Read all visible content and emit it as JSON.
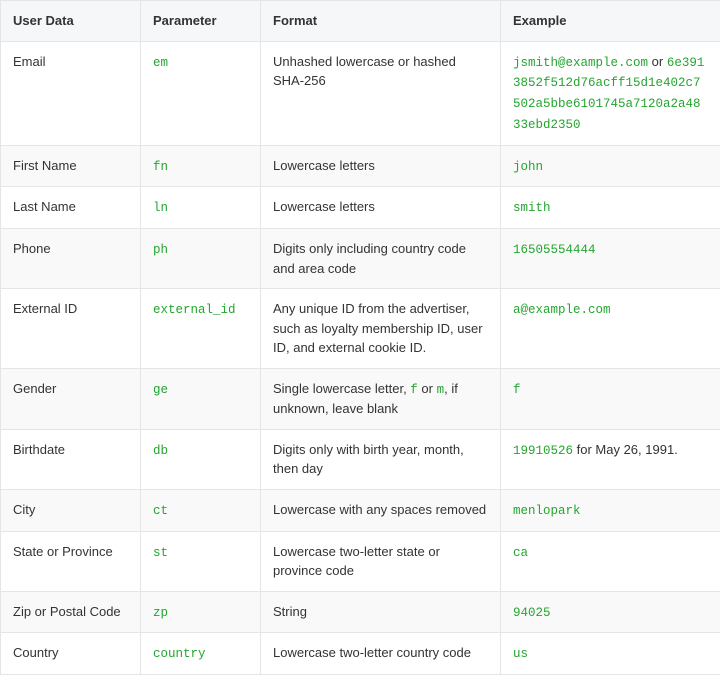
{
  "headers": {
    "user_data": "User Data",
    "parameter": "Parameter",
    "format": "Format",
    "example": "Example"
  },
  "rows": [
    {
      "user_data": "Email",
      "parameter": "em",
      "format": "Unhashed lowercase or hashed SHA-256",
      "example_code1": "jsmith@example.com",
      "example_sep": " or ",
      "example_code2": "6e3913852f512d76acff15d1e402c7502a5bbe6101745a7120a2a4833ebd2350"
    },
    {
      "user_data": "First Name",
      "parameter": "fn",
      "format": "Lowercase letters",
      "example_code1": "john"
    },
    {
      "user_data": "Last Name",
      "parameter": "ln",
      "format": "Lowercase letters",
      "example_code1": "smith"
    },
    {
      "user_data": "Phone",
      "parameter": "ph",
      "format": "Digits only including country code and area code",
      "example_code1": "16505554444"
    },
    {
      "user_data": "External ID",
      "parameter": "external_id",
      "format": "Any unique ID from the advertiser, such as loyalty membership ID, user ID, and external cookie ID.",
      "example_code1": "a@example.com"
    },
    {
      "user_data": "Gender",
      "parameter": "ge",
      "format_pre": "Single lowercase letter, ",
      "format_code1": "f",
      "format_mid": " or ",
      "format_code2": "m",
      "format_post": ", if unknown, leave blank",
      "example_code1": "f"
    },
    {
      "user_data": "Birthdate",
      "parameter": "db",
      "format": "Digits only with birth year, month, then day",
      "example_code1": "19910526",
      "example_post": " for May 26, 1991."
    },
    {
      "user_data": "City",
      "parameter": "ct",
      "format": "Lowercase with any spaces removed",
      "example_code1": "menlopark"
    },
    {
      "user_data": "State or Province",
      "parameter": "st",
      "format": "Lowercase two-letter state or province code",
      "example_code1": "ca"
    },
    {
      "user_data": "Zip or Postal Code",
      "parameter": "zp",
      "format": "String",
      "example_code1": "94025"
    },
    {
      "user_data": "Country",
      "parameter": "country",
      "format": "Lowercase two-letter country code",
      "example_code1": "us"
    }
  ]
}
